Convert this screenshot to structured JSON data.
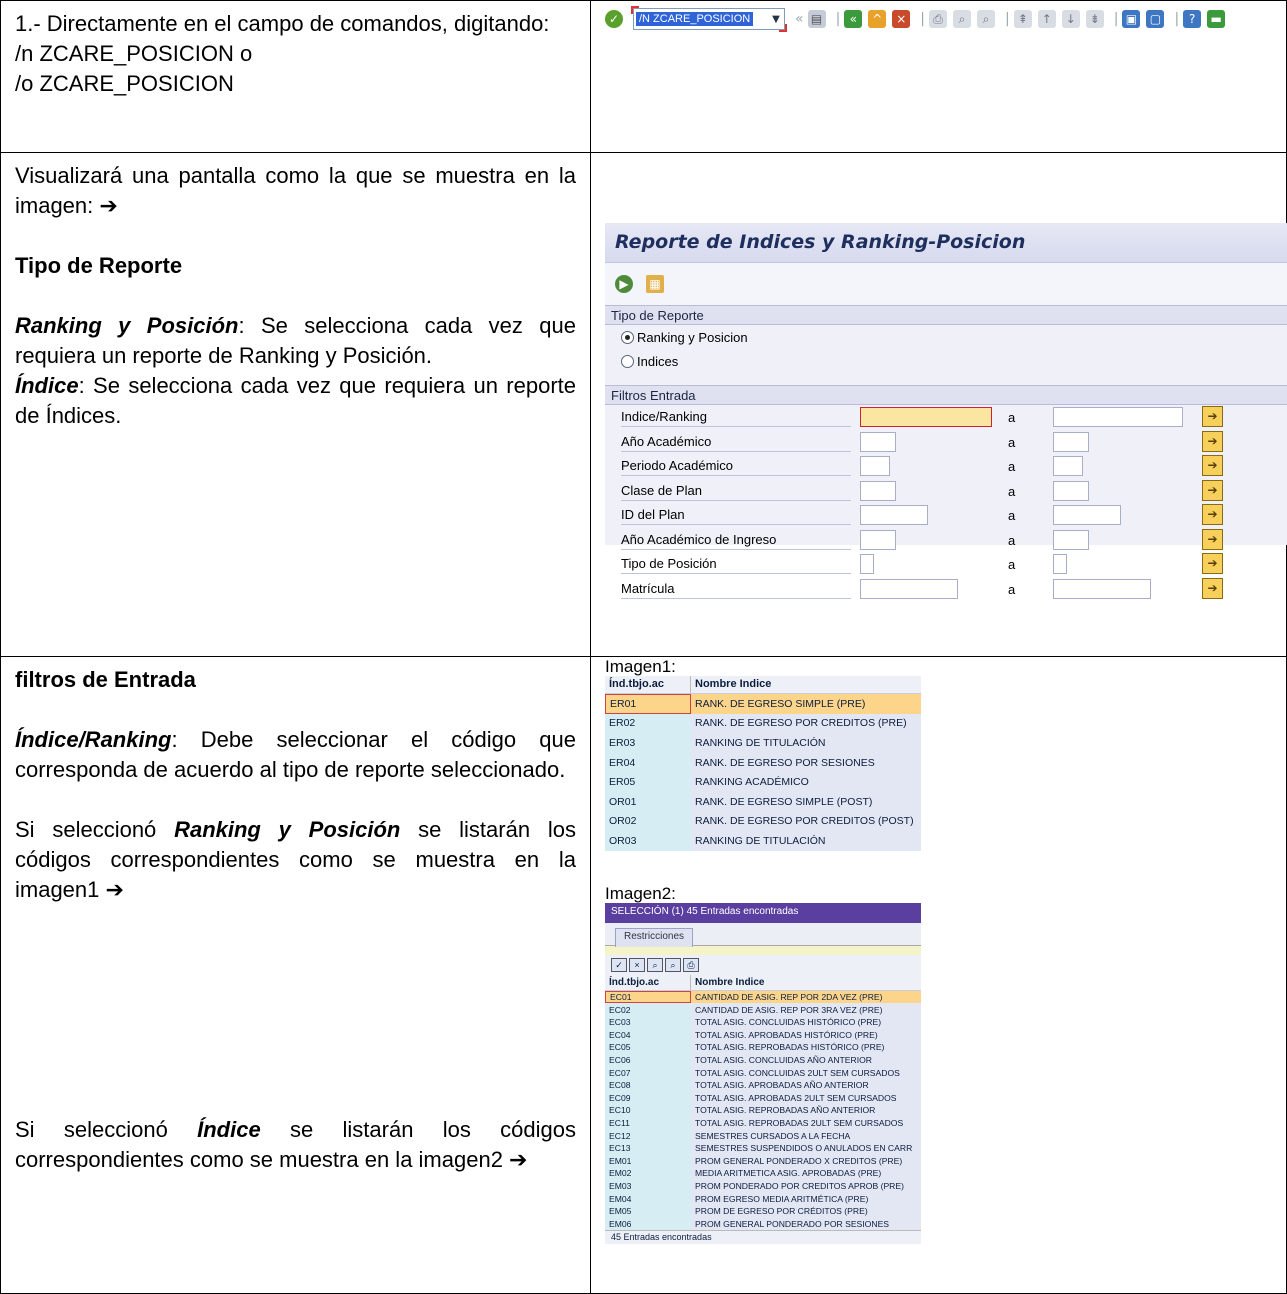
{
  "row1": {
    "text_lines": [
      "1.- Directamente en el campo de comandos, digitando:",
      " /n ZCARE_POSICION o",
      "/o ZCARE_POSICION"
    ],
    "toolbar": {
      "command_value": "/N ZCARE_POSICION",
      "icons": [
        "check-icon",
        "back-icon",
        "save-icon",
        "navigation-icons",
        "print-icon",
        "find-icon",
        "page-icons",
        "layout-icons",
        "help-icon",
        "monitor-icon"
      ]
    }
  },
  "row2": {
    "intro": "Visualizará una pantalla como la que se muestra en la imagen: ➔",
    "heading": "Tipo de Reporte",
    "ranking_term": "Ranking y Posición",
    "ranking_desc": ": Se selecciona cada vez que requiera un reporte de Ranking y Posición.",
    "indice_term": "Índice",
    "indice_desc": ": Se selecciona cada vez que requiera un reporte de Índices.",
    "screen": {
      "title": "Reporte de Indices y Ranking-Posicion",
      "group1_title": "Tipo de Reporte",
      "radio1": "Ranking y Posicion",
      "radio2": "Indices",
      "group2_title": "Filtros Entrada",
      "fields": [
        {
          "label": "Indice/Ranking"
        },
        {
          "label": "Año Académico"
        },
        {
          "label": "Periodo Académico"
        },
        {
          "label": "Clase de Plan"
        },
        {
          "label": "ID del Plan"
        },
        {
          "label": "Año Académico de Ingreso"
        },
        {
          "label": "Tipo de Posición"
        },
        {
          "label": "Matrícula"
        }
      ],
      "range_sep": "a",
      "check_mark": "☑"
    }
  },
  "row3": {
    "heading": "filtros de Entrada",
    "indice_term": "Índice/Ranking",
    "indice_desc": ": Debe seleccionar el código que corresponda de acuerdo al tipo de reporte seleccionado.",
    "p2_prefix": "Si seleccionó ",
    "p2_term": "Ranking y Posición",
    "p2_suffix": " se listarán los códigos correspondientes como se muestra en la imagen1 ➔",
    "p3_prefix": "Si seleccionó ",
    "p3_term": "Índice",
    "p3_suffix": " se listarán los códigos correspondientes como se muestra en la imagen2 ➔",
    "image1": {
      "label": "Imagen1:",
      "col1": "Índ.tbjo.ac",
      "col2": "Nombre Indice",
      "rows": [
        [
          "ER01",
          "RANK. DE EGRESO SIMPLE (PRE)"
        ],
        [
          "ER02",
          "RANK. DE EGRESO POR CREDITOS (PRE)"
        ],
        [
          "ER03",
          "RANKING DE TITULACIÓN"
        ],
        [
          "ER04",
          "RANK. DE EGRESO POR SESIONES"
        ],
        [
          "ER05",
          "RANKING ACADÉMICO"
        ],
        [
          "OR01",
          "RANK. DE EGRESO SIMPLE (POST)"
        ],
        [
          "OR02",
          "RANK. DE EGRESO POR CREDITOS (POST)"
        ],
        [
          "OR03",
          "RANKING DE TITULACIÓN"
        ]
      ]
    },
    "image2": {
      "label": "Imagen2:",
      "title": "SELECCIÓN (1)   45 Entradas encontradas",
      "tab": "Restricciones",
      "col1": "Índ.tbjo.ac",
      "col2": "Nombre Indice",
      "rows": [
        [
          "EC01",
          "CANTIDAD DE ASIG. REP POR 2DA VEZ (PRE)"
        ],
        [
          "EC02",
          "CANTIDAD DE ASIG. REP POR 3RA VEZ (PRE)"
        ],
        [
          "EC03",
          "TOTAL ASIG. CONCLUIDAS HISTÓRICO (PRE)"
        ],
        [
          "EC04",
          "TOTAL ASIG. APROBADAS HISTÓRICO (PRE)"
        ],
        [
          "EC05",
          "TOTAL ASIG. REPROBADAS HISTÓRICO (PRE)"
        ],
        [
          "EC06",
          "TOTAL ASIG. CONCLUIDAS AÑO ANTERIOR"
        ],
        [
          "EC07",
          "TOTAL ASIG. CONCLUIDAS 2ULT SEM CURSADOS"
        ],
        [
          "EC08",
          "TOTAL ASIG. APROBADAS AÑO ANTERIOR"
        ],
        [
          "EC09",
          "TOTAL ASIG. APROBADAS 2ULT SEM CURSADOS"
        ],
        [
          "EC10",
          "TOTAL ASIG. REPROBADAS AÑO ANTERIOR"
        ],
        [
          "EC11",
          "TOTAL ASIG. REPROBADAS 2ULT SEM CURSADOS"
        ],
        [
          "EC12",
          "SEMESTRES CURSADOS A LA FECHA"
        ],
        [
          "EC13",
          "SEMESTRES SUSPENDIDOS O ANULADOS EN CARR"
        ],
        [
          "EM01",
          "PROM GENERAL PONDERADO X CREDITOS (PRE)"
        ],
        [
          "EM02",
          "MEDIA ARITMETICA ASIG. APROBADAS (PRE)"
        ],
        [
          "EM03",
          "PROM PONDERADO POR CREDITOS APROB (PRE)"
        ],
        [
          "EM04",
          "PROM EGRESO MEDIA ARITMÉTICA (PRE)"
        ],
        [
          "EM05",
          "PROM DE EGRESO POR CRÉDITOS (PRE)"
        ],
        [
          "EM06",
          "PROM GENERAL PONDERADO POR SESIONES"
        ]
      ],
      "status": "45 Entradas encontradas"
    }
  }
}
